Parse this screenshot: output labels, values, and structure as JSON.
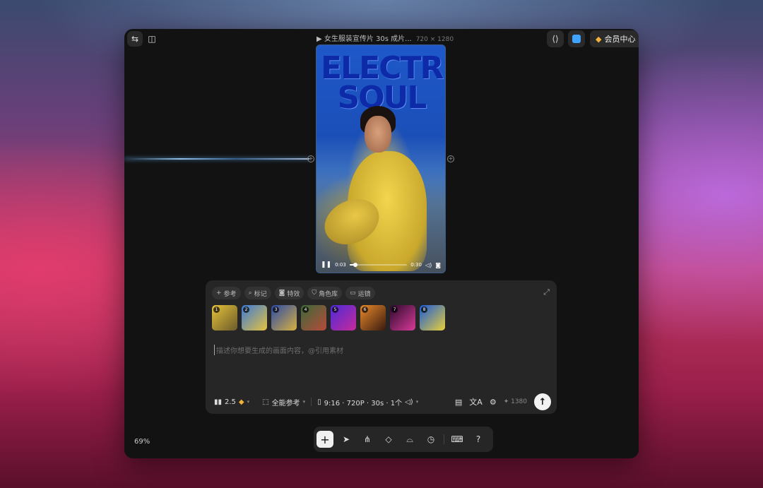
{
  "window": {
    "title": "▶ 女生服装宣传片 30s 成片...",
    "resolution": "720 × 1280",
    "member_center_label": "会员中心"
  },
  "video": {
    "graffiti_line1": "ELECTRIC",
    "graffiti_line2": "SOUL",
    "current_time": "0:03",
    "duration": "0:30",
    "progress_fraction": 0.1
  },
  "panel": {
    "chips": [
      {
        "icon": "plus-icon",
        "glyph": "+",
        "label": "参考"
      },
      {
        "icon": "search-icon",
        "glyph": "⌕",
        "label": "标记"
      },
      {
        "icon": "camera-icon",
        "glyph": "◙",
        "label": "特效"
      },
      {
        "icon": "shield-icon",
        "glyph": "⛉",
        "label": "角色库"
      },
      {
        "icon": "video-icon",
        "glyph": "▭",
        "label": "运镜"
      }
    ],
    "thumbnails": [
      {
        "number": "1",
        "color_a": "#e5c23a",
        "color_b": "#6b5a2a"
      },
      {
        "number": "2",
        "color_a": "#3a7ad8",
        "color_b": "#e6c23e"
      },
      {
        "number": "3",
        "color_a": "#2a4aa8",
        "color_b": "#d8b040"
      },
      {
        "number": "4",
        "color_a": "#3a6a3a",
        "color_b": "#b84a3a"
      },
      {
        "number": "5",
        "color_a": "#4a2ad8",
        "color_b": "#c82a9a"
      },
      {
        "number": "6",
        "color_a": "#e88a2a",
        "color_b": "#3a1a10"
      },
      {
        "number": "7",
        "color_a": "#2a0a2a",
        "color_b": "#d83a9a"
      },
      {
        "number": "8",
        "color_a": "#1a5ad8",
        "color_b": "#e8d03a"
      }
    ],
    "prompt_placeholder": "描述你想要生成的画面内容，@引用素材",
    "toolbar": {
      "model_version": "2.5",
      "reference_mode": "全能参考",
      "settings_summary": "9:16 · 720P · 30s · 1个",
      "credits": "✦ 1380"
    }
  },
  "zoom_level": "69%",
  "colors": {
    "accent_blue": "#3fa3ff",
    "gem_gold": "#f2b23a",
    "window_bg": "#121212",
    "panel_bg": "#262626"
  }
}
